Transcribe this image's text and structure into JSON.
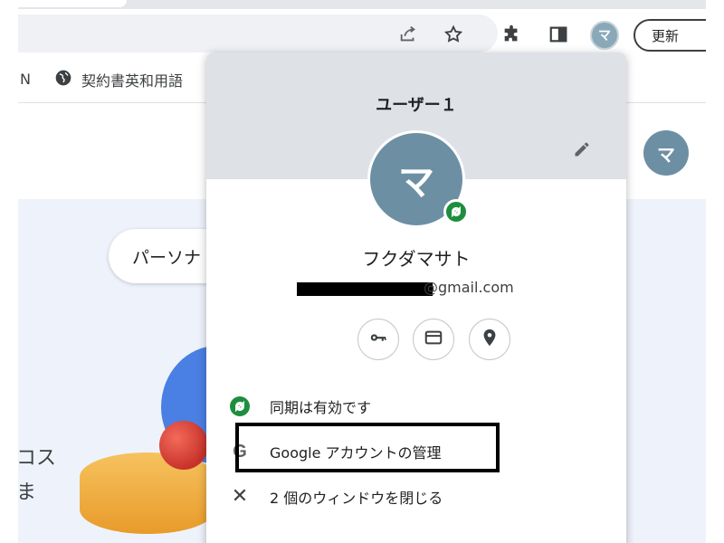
{
  "toolbar": {
    "share_icon": "share-icon",
    "bookmark_star_icon": "star-icon",
    "extensions_icon": "puzzle-icon",
    "side_panel_icon": "side-panel-icon",
    "profile_initial": "マ",
    "update_label": "更新"
  },
  "bookmarks": {
    "partial_left": "N",
    "item_label": "契約書英和用語"
  },
  "page": {
    "avatar_initial": "マ",
    "pill_text": "パーソナ",
    "side_text_1": "コス",
    "side_text_2": "ま"
  },
  "profile_menu": {
    "title": "ユーザー１",
    "avatar_initial": "マ",
    "user_name": "フクダマサト",
    "email_visible": "@gmail.com",
    "quick_actions": [
      "password-key-icon",
      "payment-card-icon",
      "address-pin-icon"
    ],
    "items": [
      {
        "label": "同期は有効です",
        "icon": "sync-icon"
      },
      {
        "label": "Google アカウントの管理",
        "icon": "google-g-icon"
      },
      {
        "label": "2 個のウィンドウを閉じる",
        "icon": "close-icon"
      }
    ]
  },
  "colors": {
    "menu_header_bg": "#dee1e6",
    "avatar_bg": "#6d8fa3",
    "sync_green": "#1e8e3e",
    "page_bg": "#eef3fb"
  }
}
